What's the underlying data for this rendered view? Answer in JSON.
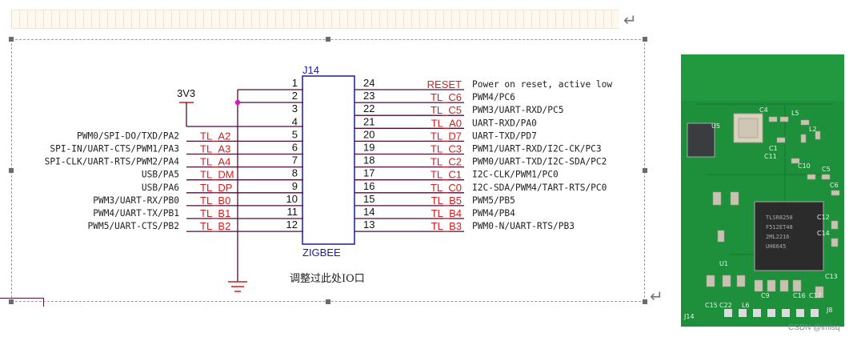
{
  "connector": {
    "ref": "J14",
    "name": "ZIGBEE",
    "power_label": "3V3",
    "note": "调整过此处IO口",
    "left_pins": [
      {
        "num": "1",
        "net": "",
        "func": ""
      },
      {
        "num": "2",
        "net": "",
        "func": ""
      },
      {
        "num": "3",
        "net": "",
        "func": ""
      },
      {
        "num": "4",
        "net": "",
        "func": ""
      },
      {
        "num": "5",
        "net": "TL_A2",
        "func": "PWM0/SPI-DO/TXD/PA2"
      },
      {
        "num": "6",
        "net": "TL_A3",
        "func": "SPI-IN/UART-CTS/PWM1/PA3"
      },
      {
        "num": "7",
        "net": "TL_A4",
        "func": "SPI-CLK/UART-RTS/PWM2/PA4"
      },
      {
        "num": "8",
        "net": "TL_DM",
        "func": "USB/PA5"
      },
      {
        "num": "9",
        "net": "TL_DP",
        "func": "USB/PA6"
      },
      {
        "num": "10",
        "net": "TL_B0",
        "func": "PWM3/UART-RX/PB0"
      },
      {
        "num": "11",
        "net": "TL_B1",
        "func": "PWM4/UART-TX/PB1"
      },
      {
        "num": "12",
        "net": "TL_B2",
        "func": "PWM5/UART-CTS/PB2"
      }
    ],
    "right_pins": [
      {
        "num": "24",
        "net": "RESET",
        "func": "Power on reset, active low"
      },
      {
        "num": "23",
        "net": "TL_C6",
        "func": "PWM4/PC6"
      },
      {
        "num": "22",
        "net": "TL_C5",
        "func": "PWM3/UART-RXD/PC5"
      },
      {
        "num": "21",
        "net": "TL_A0",
        "func": "UART-RXD/PA0"
      },
      {
        "num": "20",
        "net": "TL_D7",
        "func": "UART-TXD/PD7"
      },
      {
        "num": "19",
        "net": "TL_C3",
        "func": "PWM1/UART-RXD/I2C-CK/PC3"
      },
      {
        "num": "18",
        "net": "TL_C2",
        "func": "PWM0/UART-TXD/I2C-SDA/PC2"
      },
      {
        "num": "17",
        "net": "TL_C1",
        "func": "I2C-CLK/PWM1/PC0"
      },
      {
        "num": "16",
        "net": "TL_C0",
        "func": "I2C-SDA/PWM4/TART-RTS/PC0"
      },
      {
        "num": "15",
        "net": "TL_B5",
        "func": "PWM5/PB5"
      },
      {
        "num": "14",
        "net": "TL_B4",
        "func": "PWM4/PB4"
      },
      {
        "num": "13",
        "net": "TL_B3",
        "func": "PWM0-N/UART-RTS/PB3"
      }
    ]
  },
  "photo": {
    "chip_text": [
      "TLSR8258",
      "F512ET48",
      "2ML2216",
      "UH6645"
    ],
    "silk_labels": [
      "U5",
      "C1",
      "L5",
      "C11",
      "C4",
      "L2",
      "C10",
      "C5",
      "C6",
      "C12",
      "C14",
      "C15",
      "U1",
      "C9",
      "C16",
      "C17",
      "C13",
      "C22",
      "L6",
      "J8",
      "J14"
    ]
  },
  "watermark": "CSDN @imlsq",
  "colors": {
    "pin_line": "#4a0d34",
    "net_label": "#d81b1b",
    "connector_box": "#1a1aa8",
    "pcb_green": "#1e8f3a",
    "junction": "#e010c8"
  },
  "icons": [
    "paragraph-mark-icon",
    "ground-symbol-icon",
    "power-port-icon"
  ]
}
